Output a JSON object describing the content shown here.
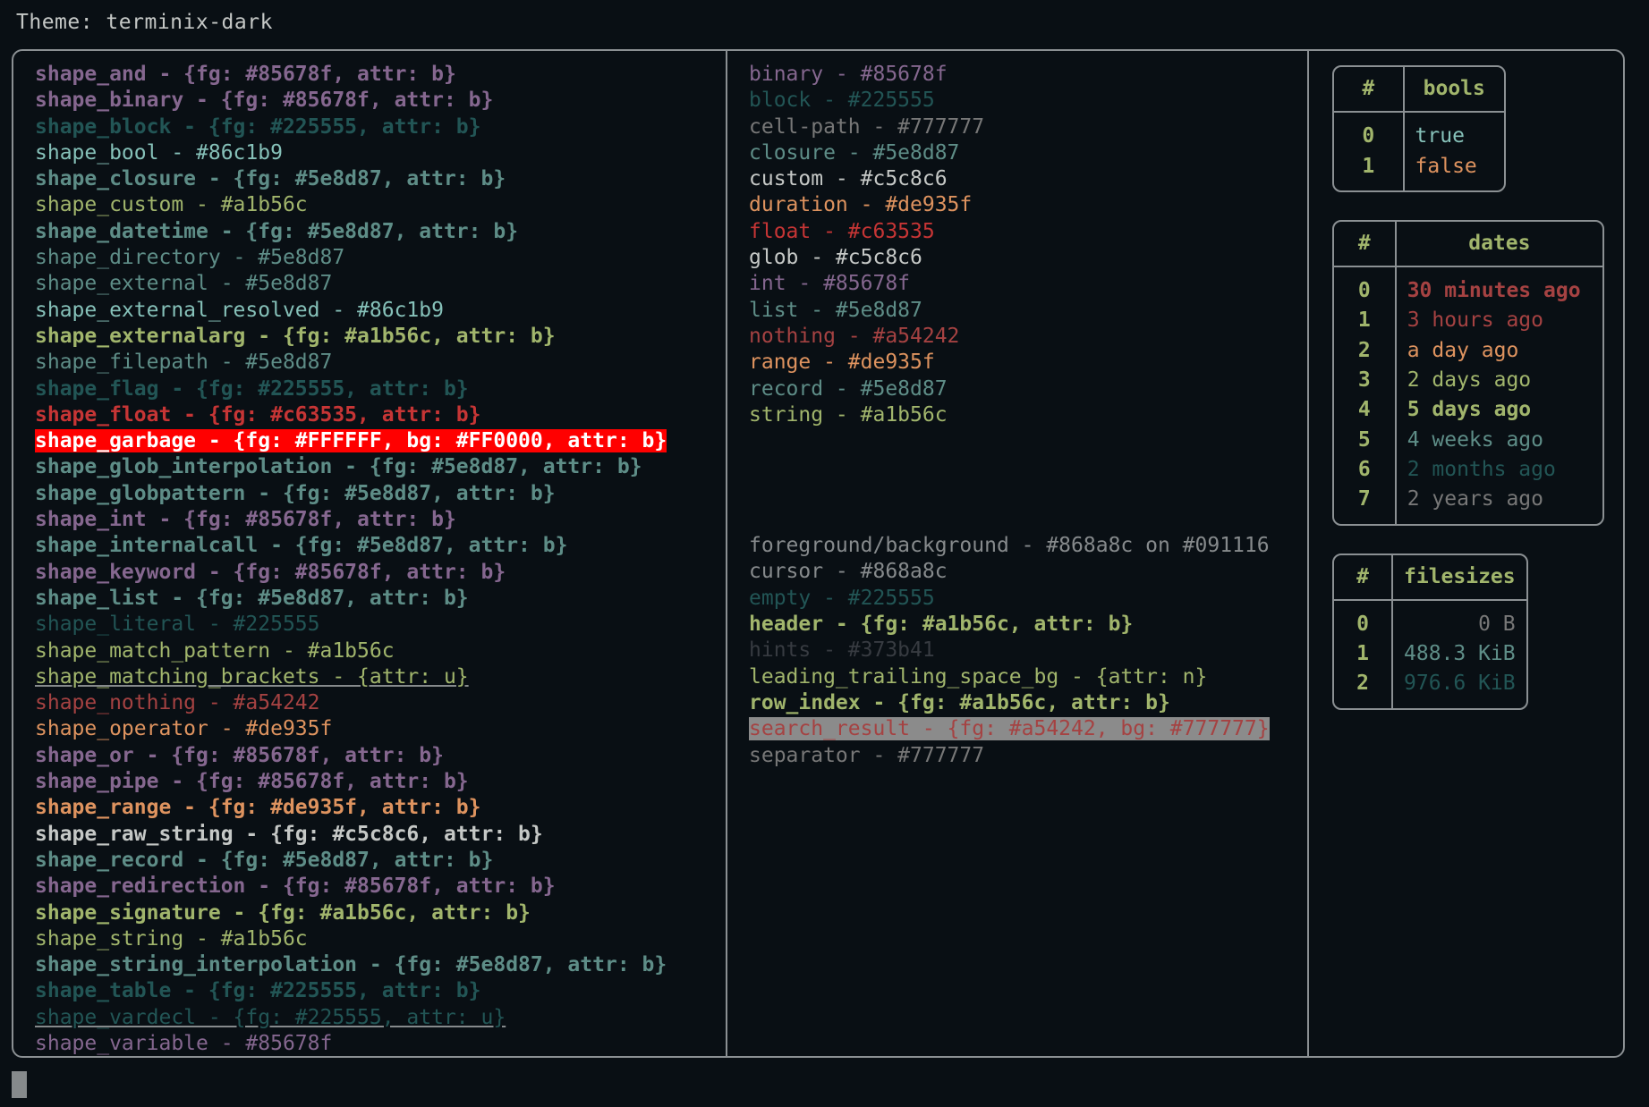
{
  "theme_label": "Theme: terminix-dark",
  "palette": {
    "background": "#091116",
    "foreground": "#868a8c",
    "white": "#c5c8c6",
    "purple": "#85678f",
    "teal_dark": "#225555",
    "cyan": "#86c1b9",
    "teal": "#5e8d87",
    "yellow_green": "#a1b56c",
    "red": "#c63535",
    "dark_red": "#a54242",
    "orange": "#de935f",
    "grey": "#777777",
    "hints": "#373b41",
    "garbage_fg": "#FFFFFF",
    "garbage_bg": "#FF0000",
    "search_bg": "#777777",
    "border": "#8b9093"
  },
  "left_column": [
    {
      "text": "shape_and - {fg: #85678f, attr: b}",
      "fg": "#85678f",
      "bold": true
    },
    {
      "text": "shape_binary - {fg: #85678f, attr: b}",
      "fg": "#85678f",
      "bold": true
    },
    {
      "text": "shape_block - {fg: #225555, attr: b}",
      "fg": "#225555",
      "bold": true
    },
    {
      "text": "shape_bool - #86c1b9",
      "fg": "#86c1b9",
      "bold": false
    },
    {
      "text": "shape_closure - {fg: #5e8d87, attr: b}",
      "fg": "#5e8d87",
      "bold": true
    },
    {
      "text": "shape_custom - #a1b56c",
      "fg": "#a1b56c",
      "bold": false
    },
    {
      "text": "shape_datetime - {fg: #5e8d87, attr: b}",
      "fg": "#5e8d87",
      "bold": true
    },
    {
      "text": "shape_directory - #5e8d87",
      "fg": "#5e8d87",
      "bold": false
    },
    {
      "text": "shape_external - #5e8d87",
      "fg": "#5e8d87",
      "bold": false
    },
    {
      "text": "shape_external_resolved - #86c1b9",
      "fg": "#86c1b9",
      "bold": false
    },
    {
      "text": "shape_externalarg - {fg: #a1b56c, attr: b}",
      "fg": "#a1b56c",
      "bold": true
    },
    {
      "text": "shape_filepath - #5e8d87",
      "fg": "#5e8d87",
      "bold": false
    },
    {
      "text": "shape_flag - {fg: #225555, attr: b}",
      "fg": "#225555",
      "bold": true
    },
    {
      "text": "shape_float - {fg: #c63535, attr: b}",
      "fg": "#c63535",
      "bold": true
    },
    {
      "text": "shape_garbage - {fg: #FFFFFF, bg: #FF0000, attr: b}",
      "fg": "#FFFFFF",
      "bg": "#FF0000",
      "bold": true
    },
    {
      "text": "shape_glob_interpolation - {fg: #5e8d87, attr: b}",
      "fg": "#5e8d87",
      "bold": true
    },
    {
      "text": "shape_globpattern - {fg: #5e8d87, attr: b}",
      "fg": "#5e8d87",
      "bold": true
    },
    {
      "text": "shape_int - {fg: #85678f, attr: b}",
      "fg": "#85678f",
      "bold": true
    },
    {
      "text": "shape_internalcall - {fg: #5e8d87, attr: b}",
      "fg": "#5e8d87",
      "bold": true
    },
    {
      "text": "shape_keyword - {fg: #85678f, attr: b}",
      "fg": "#85678f",
      "bold": true
    },
    {
      "text": "shape_list - {fg: #5e8d87, attr: b}",
      "fg": "#5e8d87",
      "bold": true
    },
    {
      "text": "shape_literal - #225555",
      "fg": "#225555",
      "bold": false
    },
    {
      "text": "shape_match_pattern - #a1b56c",
      "fg": "#a1b56c",
      "bold": false
    },
    {
      "text": "shape_matching_brackets - {attr: u}",
      "fg": "#a1b56c",
      "bold": false,
      "underline": true
    },
    {
      "text": "shape_nothing - #a54242",
      "fg": "#a54242",
      "bold": false
    },
    {
      "text": "shape_operator - #de935f",
      "fg": "#de935f",
      "bold": false
    },
    {
      "text": "shape_or - {fg: #85678f, attr: b}",
      "fg": "#85678f",
      "bold": true
    },
    {
      "text": "shape_pipe - {fg: #85678f, attr: b}",
      "fg": "#85678f",
      "bold": true
    },
    {
      "text": "shape_range - {fg: #de935f, attr: b}",
      "fg": "#de935f",
      "bold": true
    },
    {
      "text": "shape_raw_string - {fg: #c5c8c6, attr: b}",
      "fg": "#c5c8c6",
      "bold": true
    },
    {
      "text": "shape_record - {fg: #5e8d87, attr: b}",
      "fg": "#5e8d87",
      "bold": true
    },
    {
      "text": "shape_redirection - {fg: #85678f, attr: b}",
      "fg": "#85678f",
      "bold": true
    },
    {
      "text": "shape_signature - {fg: #a1b56c, attr: b}",
      "fg": "#a1b56c",
      "bold": true
    },
    {
      "text": "shape_string - #a1b56c",
      "fg": "#a1b56c",
      "bold": false
    },
    {
      "text": "shape_string_interpolation - {fg: #5e8d87, attr: b}",
      "fg": "#5e8d87",
      "bold": true
    },
    {
      "text": "shape_table - {fg: #225555, attr: b}",
      "fg": "#225555",
      "bold": true
    },
    {
      "text": "shape_vardecl - {fg: #225555, attr: u}",
      "fg": "#225555",
      "bold": false,
      "underline": true
    },
    {
      "text": "shape_variable - #85678f",
      "fg": "#85678f",
      "bold": false
    }
  ],
  "mid_column_types": [
    {
      "text": "binary - #85678f",
      "fg": "#85678f",
      "bold": false
    },
    {
      "text": "block - #225555",
      "fg": "#225555",
      "bold": false
    },
    {
      "text": "cell-path - #777777",
      "fg": "#777777",
      "bold": false
    },
    {
      "text": "closure - #5e8d87",
      "fg": "#5e8d87",
      "bold": false
    },
    {
      "text": "custom - #c5c8c6",
      "fg": "#c5c8c6",
      "bold": false
    },
    {
      "text": "duration - #de935f",
      "fg": "#de935f",
      "bold": false
    },
    {
      "text": "float - #c63535",
      "fg": "#c63535",
      "bold": false
    },
    {
      "text": "glob - #c5c8c6",
      "fg": "#c5c8c6",
      "bold": false
    },
    {
      "text": "int - #85678f",
      "fg": "#85678f",
      "bold": false
    },
    {
      "text": "list - #5e8d87",
      "fg": "#5e8d87",
      "bold": false
    },
    {
      "text": "nothing - #a54242",
      "fg": "#a54242",
      "bold": false
    },
    {
      "text": "range - #de935f",
      "fg": "#de935f",
      "bold": false
    },
    {
      "text": "record - #5e8d87",
      "fg": "#5e8d87",
      "bold": false
    },
    {
      "text": "string - #a1b56c",
      "fg": "#a1b56c",
      "bold": false
    }
  ],
  "mid_column_ui": [
    {
      "text": "foreground/background - #868a8c on #091116",
      "fg": "#868a8c",
      "bold": false
    },
    {
      "text": "cursor - #868a8c",
      "fg": "#868a8c",
      "bold": false
    },
    {
      "text": "empty - #225555",
      "fg": "#225555",
      "bold": false
    },
    {
      "text": "header - {fg: #a1b56c, attr: b}",
      "fg": "#a1b56c",
      "bold": true
    },
    {
      "text": "hints - #373b41",
      "fg": "#373b41",
      "bold": false
    },
    {
      "text": "leading_trailing_space_bg - {attr: n}",
      "fg": "#a1b56c",
      "bold": false
    },
    {
      "text": "row_index - {fg: #a1b56c, attr: b}",
      "fg": "#a1b56c",
      "bold": true
    },
    {
      "text": "search_result - {fg: #a54242, bg: #777777}",
      "fg": "#a54242",
      "bg": "#8b8b8b",
      "bold": false
    },
    {
      "text": "separator - #777777",
      "fg": "#777777",
      "bold": false
    }
  ],
  "tables": [
    {
      "name": "bools",
      "index_header": "#",
      "value_header": "bools",
      "align": "left",
      "rows": [
        {
          "index": "0",
          "value": "true",
          "fg": "#86c1b9",
          "bold": false
        },
        {
          "index": "1",
          "value": "false",
          "fg": "#de935f",
          "bold": false
        }
      ]
    },
    {
      "name": "dates",
      "index_header": "#",
      "value_header": "dates",
      "align": "left",
      "rows": [
        {
          "index": "0",
          "value": "30 minutes ago",
          "fg": "#a54242",
          "bold": true
        },
        {
          "index": "1",
          "value": "3 hours ago",
          "fg": "#a54242",
          "bold": false
        },
        {
          "index": "2",
          "value": "a day ago",
          "fg": "#de935f",
          "bold": false
        },
        {
          "index": "3",
          "value": "2 days ago",
          "fg": "#a1b56c",
          "bold": false
        },
        {
          "index": "4",
          "value": "5 days ago",
          "fg": "#a1b56c",
          "bold": true
        },
        {
          "index": "5",
          "value": "4 weeks ago",
          "fg": "#5e8d87",
          "bold": false
        },
        {
          "index": "6",
          "value": "2 months ago",
          "fg": "#225555",
          "bold": false
        },
        {
          "index": "7",
          "value": "2 years ago",
          "fg": "#777777",
          "bold": false
        }
      ]
    },
    {
      "name": "filesizes",
      "index_header": "#",
      "value_header": "filesizes",
      "align": "right",
      "rows": [
        {
          "index": "0",
          "value": "0 B",
          "fg": "#777777",
          "bold": false
        },
        {
          "index": "1",
          "value": "488.3 KiB",
          "fg": "#5e8d87",
          "bold": false
        },
        {
          "index": "2",
          "value": "976.6 KiB",
          "fg": "#225555",
          "bold": false
        }
      ]
    }
  ]
}
